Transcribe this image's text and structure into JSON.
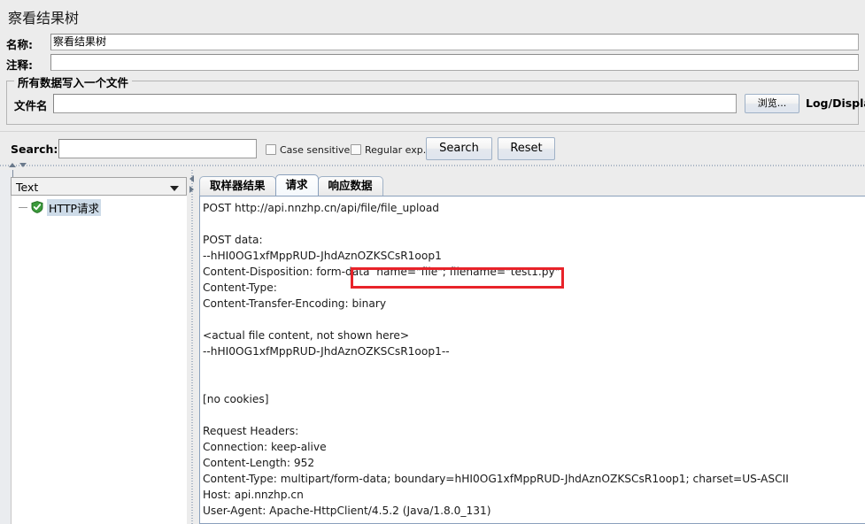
{
  "window": {
    "title": "察看结果树"
  },
  "form": {
    "name_label": "名称:",
    "name_value": "察看结果树",
    "comment_label": "注释:",
    "comment_value": ""
  },
  "file_group": {
    "legend": "所有数据写入一个文件",
    "filename_label": "文件名",
    "filename_value": "",
    "browse_label": "浏览...",
    "log_display_label": "Log/Display O"
  },
  "search": {
    "label": "Search:",
    "value": "",
    "case_sensitive_label": "Case sensitive",
    "case_sensitive_checked": false,
    "regular_exp_label": "Regular exp.",
    "regular_exp_checked": false,
    "search_button": "Search",
    "reset_button": "Reset"
  },
  "tree_panel": {
    "renderer_selected": "Text",
    "node_label": "HTTP请求",
    "node_status_icon": "green-shield-check-icon"
  },
  "tabs": [
    {
      "label": "取样器结果",
      "selected": false
    },
    {
      "label": "请求",
      "selected": true
    },
    {
      "label": "响应数据",
      "selected": false
    }
  ],
  "request_view": {
    "lines": [
      "POST http://api.nnzhp.cn/api/file/file_upload",
      "",
      "POST data:",
      "--hHI0OG1xfMppRUD-JhdAznOZKSCsR1oop1",
      "Content-Disposition: form-data  name=\"file\"; filename=\"test1.py\"",
      "Content-Type:",
      "Content-Transfer-Encoding: binary",
      "",
      "<actual file content, not shown here>",
      "--hHI0OG1xfMppRUD-JhdAznOZKSCsR1oop1--",
      "",
      "",
      "[no cookies]",
      "",
      "Request Headers:",
      "Connection: keep-alive",
      "Content-Length: 952",
      "Content-Type: multipart/form-data; boundary=hHI0OG1xfMppRUD-JhdAznOZKSCsR1oop1; charset=US-ASCII",
      "Host: api.nnzhp.cn",
      "User-Agent: Apache-HttpClient/4.5.2 (Java/1.8.0_131)"
    ],
    "highlight_text": "name=\"file\"; filename=\"test1.py\""
  },
  "colors": {
    "background": "#ececec",
    "field_background": "#ffffff",
    "highlight_red": "#e8232a",
    "selection_blue": "#cddbe8",
    "status_green": "#3c9a3c",
    "border_blue": "#8aa0bc"
  }
}
